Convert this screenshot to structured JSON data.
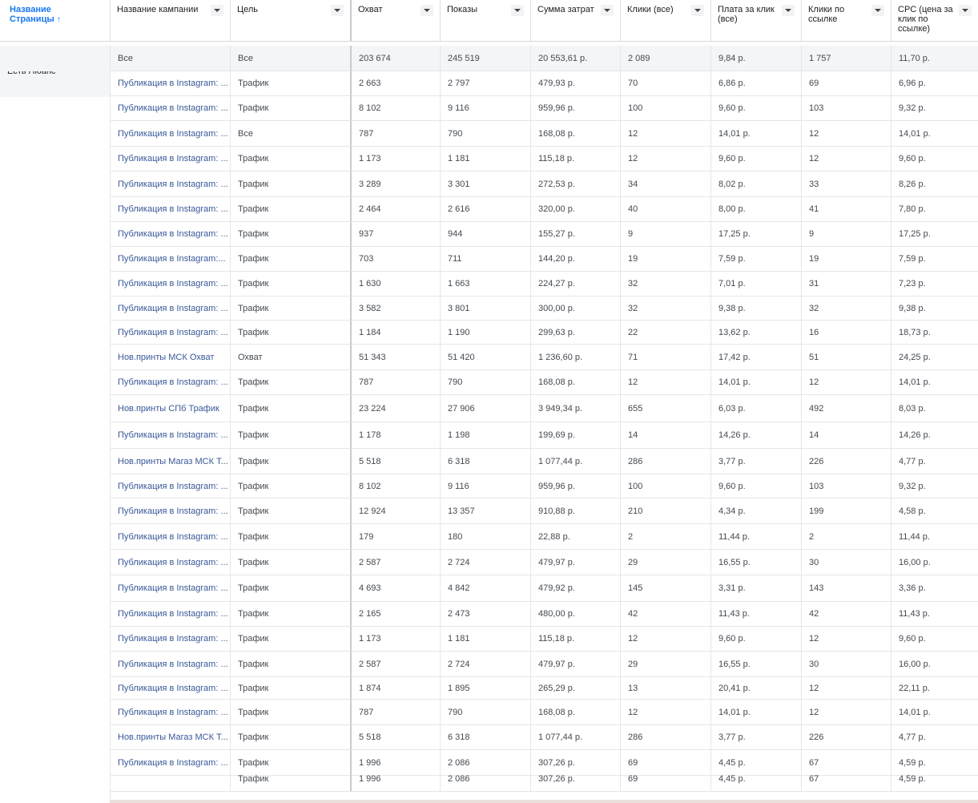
{
  "columns": [
    {
      "label": "Название Страницы",
      "sort": "↑"
    },
    {
      "label": "Название кампании"
    },
    {
      "label": "Цель"
    },
    {
      "label": "Охват"
    },
    {
      "label": "Показы"
    },
    {
      "label": "Сумма затрат"
    },
    {
      "label": "Клики (все)"
    },
    {
      "label": "Плата за клик (все)"
    },
    {
      "label": "Клики по ссылке"
    },
    {
      "label": "CPC (цена за клик по ссылке)"
    }
  ],
  "page_name": "Есть Нюанс",
  "summary": {
    "campaign": "Все",
    "objective": "Все",
    "reach": "203 674",
    "impressions": "245 519",
    "spend": "20 553,61 р.",
    "clicks_all": "2 089",
    "cpc_all": "9,84 р.",
    "link_clicks": "1 757",
    "cpc_link": "11,70 р."
  },
  "rows": [
    {
      "campaign": "Публикация в Instagram: ...",
      "objective": "Трафик",
      "reach": "2 663",
      "impressions": "2 797",
      "spend": "479,93 р.",
      "clicks_all": "70",
      "cpc_all": "6,86 р.",
      "link_clicks": "69",
      "cpc_link": "6,96 р."
    },
    {
      "campaign": "Публикация в Instagram: ...",
      "objective": "Трафик",
      "reach": "8 102",
      "impressions": "9 116",
      "spend": "959,96 р.",
      "clicks_all": "100",
      "cpc_all": "9,60 р.",
      "link_clicks": "103",
      "cpc_link": "9,32 р."
    },
    {
      "campaign": "Публикация в Instagram: ...",
      "objective": "Все",
      "reach": "787",
      "impressions": "790",
      "spend": "168,08 р.",
      "clicks_all": "12",
      "cpc_all": "14,01 р.",
      "link_clicks": "12",
      "cpc_link": "14,01 р."
    },
    {
      "campaign": "Публикация в Instagram: ...",
      "objective": "Трафик",
      "reach": "1 173",
      "impressions": "1 181",
      "spend": "115,18 р.",
      "clicks_all": "12",
      "cpc_all": "9,60 р.",
      "link_clicks": "12",
      "cpc_link": "9,60 р."
    },
    {
      "campaign": "Публикация в Instagram: ...",
      "objective": "Трафик",
      "reach": "3 289",
      "impressions": "3 301",
      "spend": "272,53 р.",
      "clicks_all": "34",
      "cpc_all": "8,02 р.",
      "link_clicks": "33",
      "cpc_link": "8,26 р."
    },
    {
      "campaign": "Публикация в Instagram: ...",
      "objective": "Трафик",
      "reach": "2 464",
      "impressions": "2 616",
      "spend": "320,00 р.",
      "clicks_all": "40",
      "cpc_all": "8,00 р.",
      "link_clicks": "41",
      "cpc_link": "7,80 р."
    },
    {
      "campaign": "Публикация в Instagram: ...",
      "objective": "Трафик",
      "reach": "937",
      "impressions": "944",
      "spend": "155,27 р.",
      "clicks_all": "9",
      "cpc_all": "17,25 р.",
      "link_clicks": "9",
      "cpc_link": "17,25 р."
    },
    {
      "campaign": "Публикация в Instagram:...",
      "objective": "Трафик",
      "reach": "703",
      "impressions": "711",
      "spend": "144,20 р.",
      "clicks_all": "19",
      "cpc_all": "7,59 р.",
      "link_clicks": "19",
      "cpc_link": "7,59 р."
    },
    {
      "campaign": "Публикация в Instagram: ...",
      "objective": "Трафик",
      "reach": "1 630",
      "impressions": "1 663",
      "spend": "224,27 р.",
      "clicks_all": "32",
      "cpc_all": "7,01 р.",
      "link_clicks": "31",
      "cpc_link": "7,23 р."
    },
    {
      "campaign": "Публикация в Instagram: ...",
      "objective": "Трафик",
      "reach": "3 582",
      "impressions": "3 801",
      "spend": "300,00 р.",
      "clicks_all": "32",
      "cpc_all": "9,38 р.",
      "link_clicks": "32",
      "cpc_link": "9,38 р."
    },
    {
      "campaign": "Публикация в Instagram: ...",
      "objective": "Трафик",
      "reach": "1 184",
      "impressions": "1 190",
      "spend": "299,63 р.",
      "clicks_all": "22",
      "cpc_all": "13,62 р.",
      "link_clicks": "16",
      "cpc_link": "18,73 р."
    },
    {
      "campaign": "Нов.принты МСК Охват",
      "objective": "Охват",
      "reach": "51 343",
      "impressions": "51 420",
      "spend": "1 236,60 р.",
      "clicks_all": "71",
      "cpc_all": "17,42 р.",
      "link_clicks": "51",
      "cpc_link": "24,25 р."
    },
    {
      "campaign": "Публикация в Instagram: ...",
      "objective": "Трафик",
      "reach": "787",
      "impressions": "790",
      "spend": "168,08 р.",
      "clicks_all": "12",
      "cpc_all": "14,01 р.",
      "link_clicks": "12",
      "cpc_link": "14,01 р."
    },
    {
      "campaign": "Нов.принты СПб Трафик",
      "objective": "Трафик",
      "reach": "23 224",
      "impressions": "27 906",
      "spend": "3 949,34 р.",
      "clicks_all": "655",
      "cpc_all": "6,03 р.",
      "link_clicks": "492",
      "cpc_link": "8,03 р."
    },
    {
      "campaign": "Публикация в Instagram: ...",
      "objective": "Трафик",
      "reach": "1 178",
      "impressions": "1 198",
      "spend": "199,69 р.",
      "clicks_all": "14",
      "cpc_all": "14,26 р.",
      "link_clicks": "14",
      "cpc_link": "14,26 р."
    },
    {
      "campaign": "Нов.принты Магаз МСК Т...",
      "objective": "Трафик",
      "reach": "5 518",
      "impressions": "6 318",
      "spend": "1 077,44 р.",
      "clicks_all": "286",
      "cpc_all": "3,77 р.",
      "link_clicks": "226",
      "cpc_link": "4,77 р."
    },
    {
      "campaign": "Публикация в Instagram: ...",
      "objective": "Трафик",
      "reach": "8 102",
      "impressions": "9 116",
      "spend": "959,96 р.",
      "clicks_all": "100",
      "cpc_all": "9,60 р.",
      "link_clicks": "103",
      "cpc_link": "9,32 р."
    },
    {
      "campaign": "Публикация в Instagram: ...",
      "objective": "Трафик",
      "reach": "12 924",
      "impressions": "13 357",
      "spend": "910,88 р.",
      "clicks_all": "210",
      "cpc_all": "4,34 р.",
      "link_clicks": "199",
      "cpc_link": "4,58 р."
    },
    {
      "campaign": "Публикация в Instagram: ...",
      "objective": "Трафик",
      "reach": "179",
      "impressions": "180",
      "spend": "22,88 р.",
      "clicks_all": "2",
      "cpc_all": "11,44 р.",
      "link_clicks": "2",
      "cpc_link": "11,44 р."
    },
    {
      "campaign": "Публикация в Instagram: ...",
      "objective": "Трафик",
      "reach": "2 587",
      "impressions": "2 724",
      "spend": "479,97 р.",
      "clicks_all": "29",
      "cpc_all": "16,55 р.",
      "link_clicks": "30",
      "cpc_link": "16,00 р."
    },
    {
      "campaign": "Публикация в Instagram: ...",
      "objective": "Трафик",
      "reach": "4 693",
      "impressions": "4 842",
      "spend": "479,92 р.",
      "clicks_all": "145",
      "cpc_all": "3,31 р.",
      "link_clicks": "143",
      "cpc_link": "3,36 р."
    },
    {
      "campaign": "Публикация в Instagram: ...",
      "objective": "Трафик",
      "reach": "2 165",
      "impressions": "2 473",
      "spend": "480,00 р.",
      "clicks_all": "42",
      "cpc_all": "11,43 р.",
      "link_clicks": "42",
      "cpc_link": "11,43 р."
    },
    {
      "campaign": "Публикация в Instagram: ...",
      "objective": "Трафик",
      "reach": "1 173",
      "impressions": "1 181",
      "spend": "115,18 р.",
      "clicks_all": "12",
      "cpc_all": "9,60 р.",
      "link_clicks": "12",
      "cpc_link": "9,60 р."
    },
    {
      "campaign": "Публикация в Instagram: ...",
      "objective": "Трафик",
      "reach": "2 587",
      "impressions": "2 724",
      "spend": "479,97 р.",
      "clicks_all": "29",
      "cpc_all": "16,55 р.",
      "link_clicks": "30",
      "cpc_link": "16,00 р."
    },
    {
      "campaign": "Публикация в Instagram: ...",
      "objective": "Трафик",
      "reach": "1 874",
      "impressions": "1 895",
      "spend": "265,29 р.",
      "clicks_all": "13",
      "cpc_all": "20,41 р.",
      "link_clicks": "12",
      "cpc_link": "22,11 р."
    },
    {
      "campaign": "Публикация в Instagram: ...",
      "objective": "Трафик",
      "reach": "787",
      "impressions": "790",
      "spend": "168,08 р.",
      "clicks_all": "12",
      "cpc_all": "14,01 р.",
      "link_clicks": "12",
      "cpc_link": "14,01 р."
    },
    {
      "campaign": "Нов.принты Магаз МСК Т...",
      "objective": "Трафик",
      "reach": "5 518",
      "impressions": "6 318",
      "spend": "1 077,44 р.",
      "clicks_all": "286",
      "cpc_all": "3,77 р.",
      "link_clicks": "226",
      "cpc_link": "4,77 р."
    },
    {
      "campaign": "Публикация в Instagram: ...",
      "objective": "Трафик",
      "reach": "1 996",
      "impressions": "2 086",
      "spend": "307,26 р.",
      "clicks_all": "69",
      "cpc_all": "4,45 р.",
      "link_clicks": "67",
      "cpc_link": "4,59 р."
    },
    {
      "campaign": "",
      "objective": "Трафик",
      "reach": "1 996",
      "impressions": "2 086",
      "spend": "307,26 р.",
      "clicks_all": "69",
      "cpc_all": "4,45 р.",
      "link_clicks": "67",
      "cpc_link": "4,59 р."
    }
  ],
  "colors": {
    "link": "#385898",
    "header_accent": "#1877f2",
    "highlight_underline": "#d35400",
    "summary_bg": "#f4f5f6"
  }
}
